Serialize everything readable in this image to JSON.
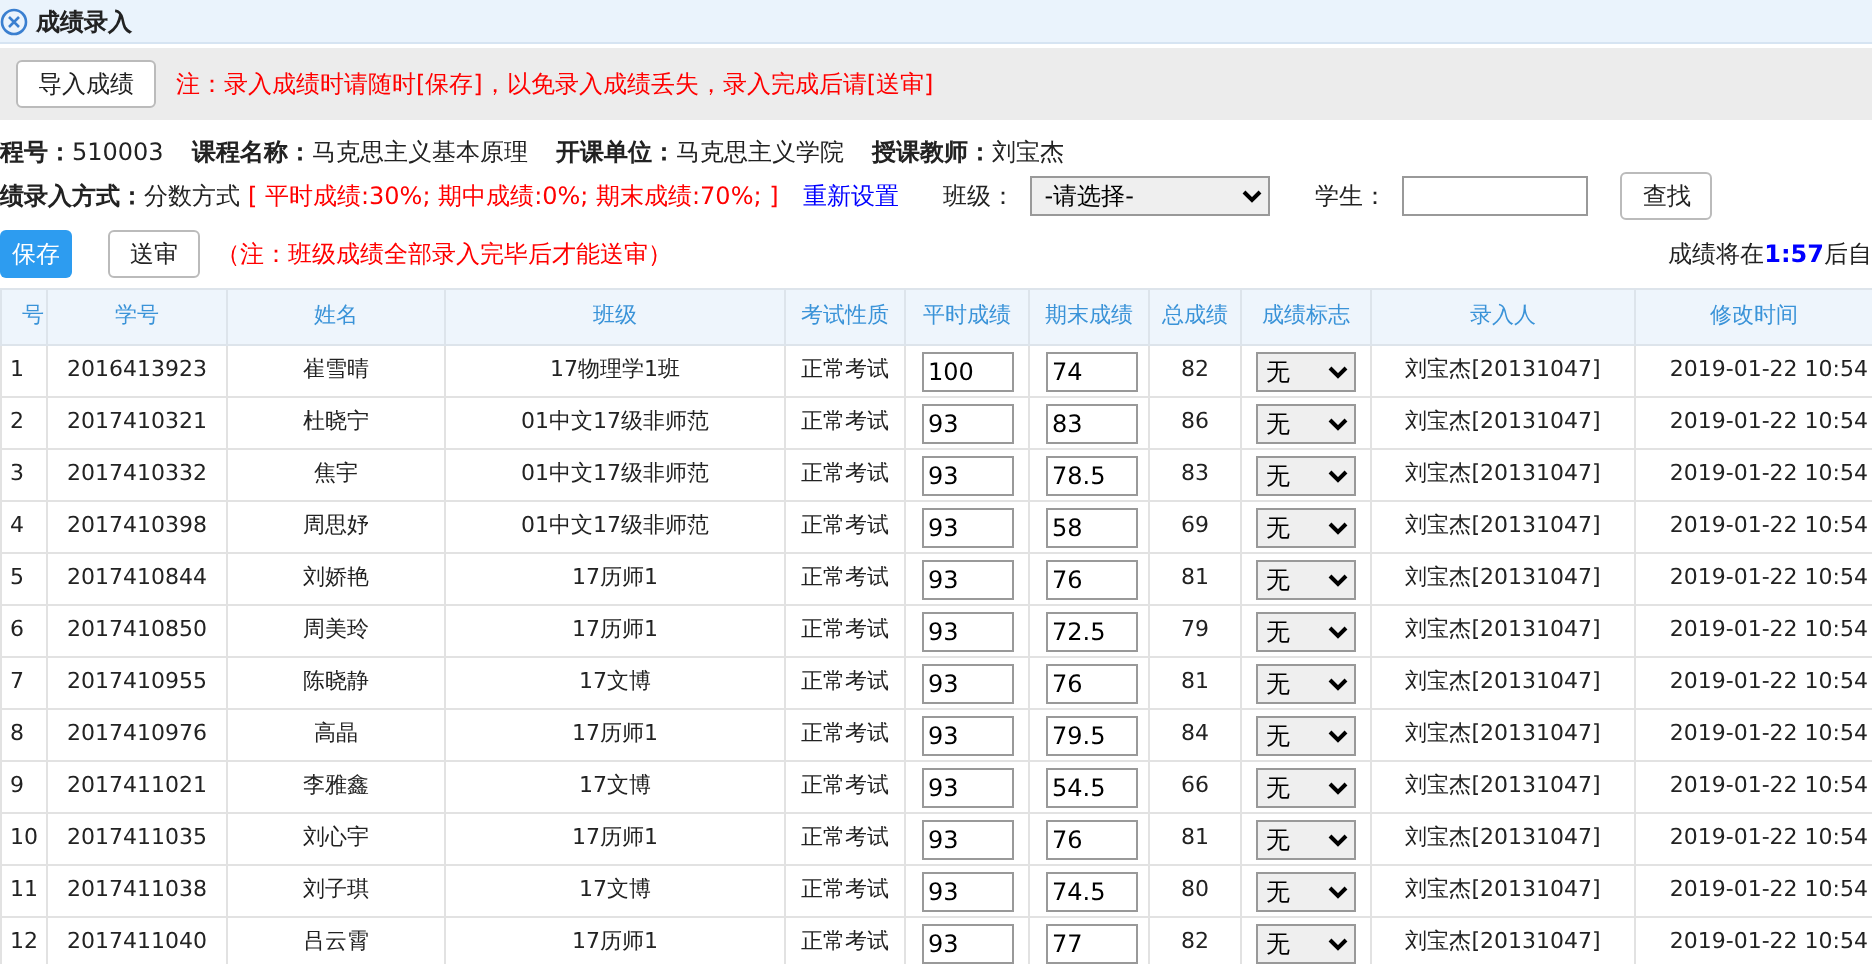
{
  "window": {
    "title": "成绩录入"
  },
  "toolbar": {
    "import_button": "导入成绩",
    "note": "注：录入成绩时请随时[保存]，以免录入成绩丢失，录入完成后请[送审]"
  },
  "course_info": [
    {
      "label": "程号：",
      "value": "510003"
    },
    {
      "label": "课程名称：",
      "value": "马克思主义基本原理"
    },
    {
      "label": "开课单位：",
      "value": "马克思主义学院"
    },
    {
      "label": "授课教师：",
      "value": "刘宝杰"
    }
  ],
  "entry_method": {
    "label": "绩录入方式：",
    "value": "分数方式",
    "weights": "[ 平时成绩:30%; 期中成绩:0%; 期末成绩:70%; ]",
    "reset_link": "重新设置",
    "class_label": "班级：",
    "class_select": "-请选择-",
    "student_label": "学生：",
    "search_button": "查找"
  },
  "actions": {
    "save_button": "保存",
    "submit_button": "送审",
    "note": "（注：班级成绩全部录入完毕后才能送审）",
    "countdown": "成绩将在**1:57**后自"
  },
  "table": {
    "columns": [
      "号",
      "学号",
      "姓名",
      "班级",
      "考试性质",
      "平时成绩",
      "期末成绩",
      "总成绩",
      "成绩标志",
      "录入人",
      "修改时间"
    ],
    "rows": [
      [
        "1",
        "2016413923",
        "崔雪晴",
        "17物理学1班",
        "正常考试",
        "100",
        "74",
        "82",
        "无",
        "刘宝杰[20131047]",
        "2019-01-22 10:54"
      ],
      [
        "2",
        "2017410321",
        "杜晓宁",
        "01中文17级非师范",
        "正常考试",
        "93",
        "83",
        "86",
        "无",
        "刘宝杰[20131047]",
        "2019-01-22 10:54"
      ],
      [
        "3",
        "2017410332",
        "焦宇",
        "01中文17级非师范",
        "正常考试",
        "93",
        "78.5",
        "83",
        "无",
        "刘宝杰[20131047]",
        "2019-01-22 10:54"
      ],
      [
        "4",
        "2017410398",
        "周思妤",
        "01中文17级非师范",
        "正常考试",
        "93",
        "58",
        "69",
        "无",
        "刘宝杰[20131047]",
        "2019-01-22 10:54"
      ],
      [
        "5",
        "2017410844",
        "刘娇艳",
        "17历师1",
        "正常考试",
        "93",
        "76",
        "81",
        "无",
        "刘宝杰[20131047]",
        "2019-01-22 10:54"
      ],
      [
        "6",
        "2017410850",
        "周美玲",
        "17历师1",
        "正常考试",
        "93",
        "72.5",
        "79",
        "无",
        "刘宝杰[20131047]",
        "2019-01-22 10:54"
      ],
      [
        "7",
        "2017410955",
        "陈晓静",
        "17文博",
        "正常考试",
        "93",
        "76",
        "81",
        "无",
        "刘宝杰[20131047]",
        "2019-01-22 10:54"
      ],
      [
        "8",
        "2017410976",
        "高晶",
        "17历师1",
        "正常考试",
        "93",
        "79.5",
        "84",
        "无",
        "刘宝杰[20131047]",
        "2019-01-22 10:54"
      ],
      [
        "9",
        "2017411021",
        "李雅鑫",
        "17文博",
        "正常考试",
        "93",
        "54.5",
        "66",
        "无",
        "刘宝杰[20131047]",
        "2019-01-22 10:54"
      ],
      [
        "10",
        "2017411035",
        "刘心宇",
        "17历师1",
        "正常考试",
        "93",
        "76",
        "81",
        "无",
        "刘宝杰[20131047]",
        "2019-01-22 10:54"
      ],
      [
        "11",
        "2017411038",
        "刘子琪",
        "17文博",
        "正常考试",
        "93",
        "74.5",
        "80",
        "无",
        "刘宝杰[20131047]",
        "2019-01-22 10:54"
      ],
      [
        "12",
        "2017411040",
        "吕云霄",
        "17历师1",
        "正常考试",
        "93",
        "77",
        "82",
        "无",
        "刘宝杰[20131047]",
        "2019-01-22 10:54"
      ]
    ]
  }
}
